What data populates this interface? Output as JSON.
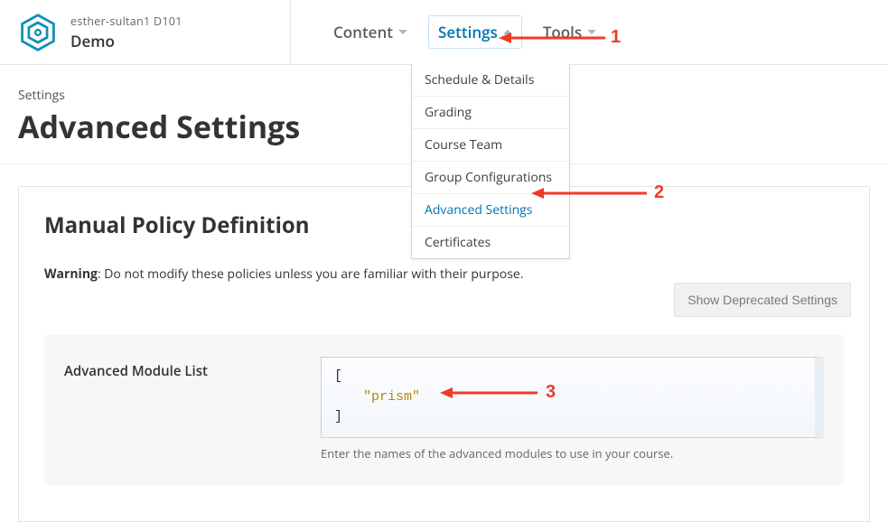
{
  "colors": {
    "accent": "#0075b4",
    "annotation": "#f03a28"
  },
  "brand": {
    "course_id": "esther-sultan1  D101",
    "course_title": "Demo"
  },
  "nav": {
    "content": "Content",
    "settings": "Settings",
    "tools": "Tools"
  },
  "dropdown": {
    "items": [
      {
        "label": "Schedule & Details"
      },
      {
        "label": "Grading"
      },
      {
        "label": "Course Team"
      },
      {
        "label": "Group Configurations"
      },
      {
        "label": "Advanced Settings"
      },
      {
        "label": "Certificates"
      }
    ]
  },
  "page": {
    "eyebrow": "Settings",
    "title": "Advanced Settings"
  },
  "panel": {
    "heading": "Manual Policy Definition",
    "warning_label": "Warning",
    "warning_text": ": Do not modify these policies unless you are familiar with their purpose.",
    "deprecated_button": "Show Deprecated Settings"
  },
  "policy": {
    "label": "Advanced Module List",
    "value_open": "[",
    "value_string": "\"prism\"",
    "value_close": "]",
    "help": "Enter the names of the advanced modules to use in your course."
  },
  "annotations": {
    "n1": "1",
    "n2": "2",
    "n3": "3"
  }
}
